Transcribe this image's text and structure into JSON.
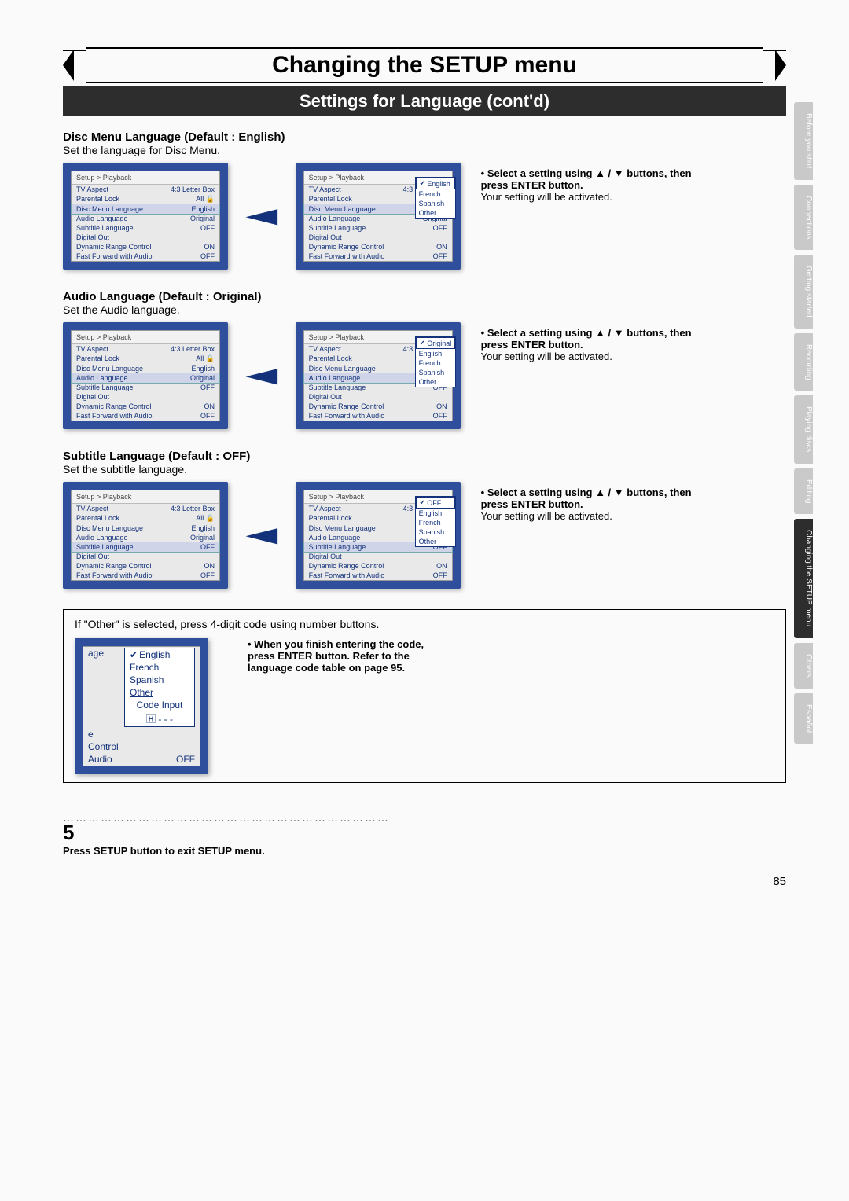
{
  "title_main": "Changing the SETUP menu",
  "subheading": "Settings for Language (cont'd)",
  "sections": {
    "discmenu": {
      "head": "Disc Menu Language (Default : English)",
      "sub": "Set the language for Disc Menu.",
      "highlight": "Disc Menu Language",
      "popup_options": [
        "English",
        "French",
        "Spanish",
        "Other"
      ],
      "popup_sel": "English"
    },
    "audio": {
      "head": "Audio Language (Default : Original)",
      "sub": "Set the Audio language.",
      "highlight": "Audio Language",
      "popup_options": [
        "Original",
        "English",
        "French",
        "Spanish",
        "Other"
      ],
      "popup_sel": "Original"
    },
    "subtitle": {
      "head": "Subtitle Language (Default : OFF)",
      "sub": "Set the subtitle language.",
      "highlight": "Subtitle Language",
      "popup_options": [
        "OFF",
        "English",
        "French",
        "Spanish",
        "Other"
      ],
      "popup_sel": "OFF"
    }
  },
  "osd": {
    "breadcrumb": "Setup > Playback",
    "rows": [
      {
        "l": "TV Aspect",
        "v": "4:3 Letter Box"
      },
      {
        "l": "Parental Lock",
        "v": "All 🔒"
      },
      {
        "l": "Disc Menu Language",
        "v": "English"
      },
      {
        "l": "Audio Language",
        "v": "Original"
      },
      {
        "l": "Subtitle Language",
        "v": "OFF"
      },
      {
        "l": "Digital Out",
        "v": ""
      },
      {
        "l": "Dynamic Range Control",
        "v": "ON"
      },
      {
        "l": "Fast Forward with Audio",
        "v": "OFF"
      }
    ]
  },
  "note_line1": "• Select a setting using ▲ / ▼ buttons, then press ENTER button.",
  "note_line2": "Your setting will be activated.",
  "info_box": {
    "text": "If \"Other\" is selected, press 4-digit code using number buttons.",
    "popup": {
      "rows": [
        "age",
        "e",
        "Control",
        "Audio"
      ],
      "opts_sel": "English",
      "opts": [
        "English",
        "French",
        "Spanish",
        "Other"
      ],
      "code_label": "Code Input",
      "code_value": "🄷 - - -",
      "audio_val": "OFF"
    },
    "note": "• When you finish entering the code, press ENTER button. Refer to the language code table on page 95."
  },
  "step": {
    "num": "5",
    "text": "Press SETUP button to exit SETUP menu."
  },
  "dots": "……………………………………………………………………",
  "side_tabs": [
    "Before you start",
    "Connections",
    "Getting started",
    "Recording",
    "Playing discs",
    "Editing",
    "Changing the SETUP menu",
    "Others",
    "Español"
  ],
  "side_active": 6,
  "page_number": "85"
}
